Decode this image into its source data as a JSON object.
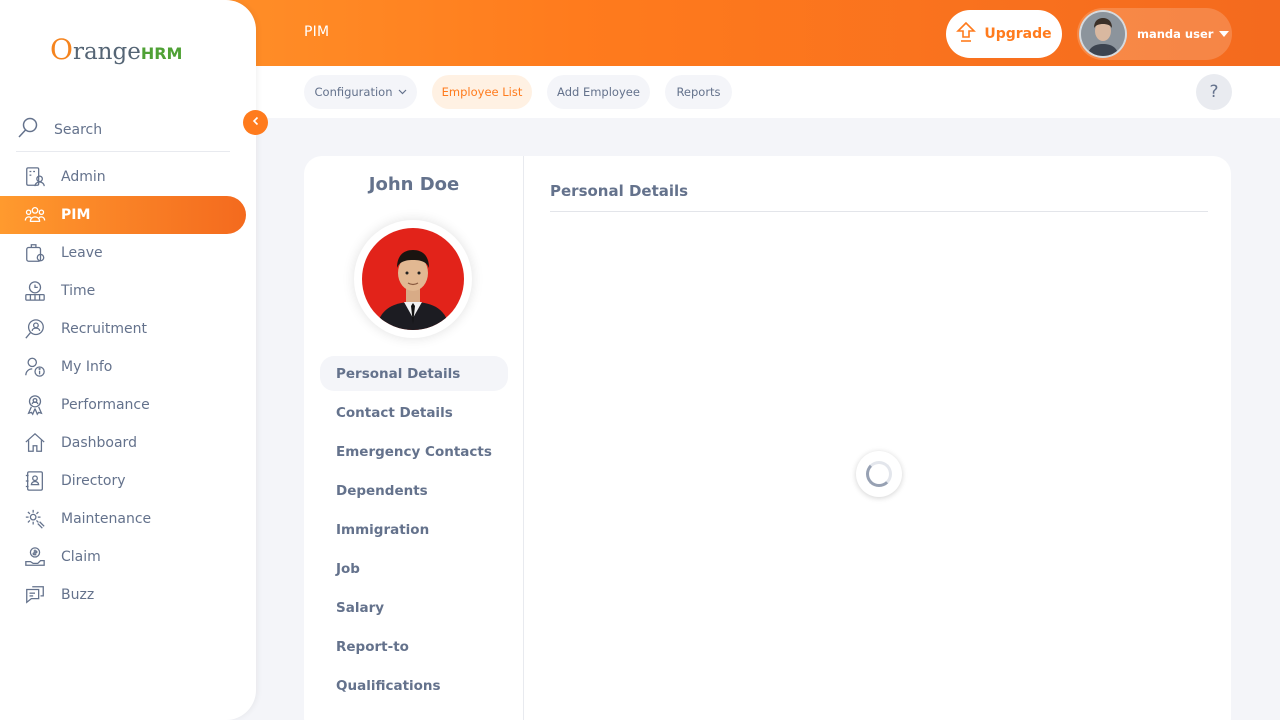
{
  "header": {
    "module_title": "PIM",
    "upgrade_label": "Upgrade",
    "user_name": "manda user"
  },
  "subnav": {
    "items": [
      {
        "label": "Configuration",
        "dropdown": true
      },
      {
        "label": "Employee List",
        "active": true
      },
      {
        "label": "Add Employee"
      },
      {
        "label": "Reports"
      }
    ],
    "help_label": "?"
  },
  "sidebar": {
    "logo": {
      "o": "O",
      "range": "range",
      "hrm": "HRM"
    },
    "search_label": "Search",
    "items": [
      {
        "label": "Admin",
        "icon": "admin-icon"
      },
      {
        "label": "PIM",
        "icon": "pim-icon",
        "active": true
      },
      {
        "label": "Leave",
        "icon": "leave-icon"
      },
      {
        "label": "Time",
        "icon": "time-icon"
      },
      {
        "label": "Recruitment",
        "icon": "recruitment-icon"
      },
      {
        "label": "My Info",
        "icon": "my-info-icon"
      },
      {
        "label": "Performance",
        "icon": "performance-icon"
      },
      {
        "label": "Dashboard",
        "icon": "dashboard-icon"
      },
      {
        "label": "Directory",
        "icon": "directory-icon"
      },
      {
        "label": "Maintenance",
        "icon": "maintenance-icon"
      },
      {
        "label": "Claim",
        "icon": "claim-icon"
      },
      {
        "label": "Buzz",
        "icon": "buzz-icon"
      }
    ]
  },
  "employee": {
    "name": "John Doe"
  },
  "tabs": [
    {
      "label": "Personal Details",
      "active": true
    },
    {
      "label": "Contact Details"
    },
    {
      "label": "Emergency Contacts"
    },
    {
      "label": "Dependents"
    },
    {
      "label": "Immigration"
    },
    {
      "label": "Job"
    },
    {
      "label": "Salary"
    },
    {
      "label": "Report-to"
    },
    {
      "label": "Qualifications"
    }
  ],
  "main": {
    "section_title": "Personal Details"
  },
  "colors": {
    "accent": "#ff7b1d",
    "text": "#64728c",
    "background": "#f4f5f9"
  }
}
